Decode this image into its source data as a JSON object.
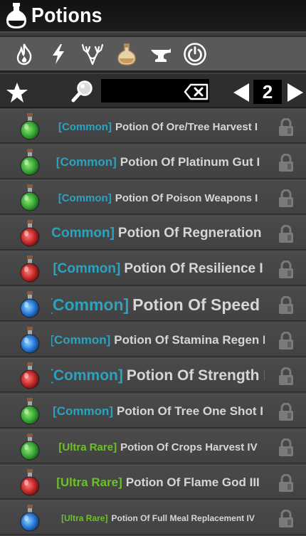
{
  "window": {
    "title": "Potions",
    "title_icon": "potion-flask-icon"
  },
  "categories": [
    {
      "name": "fire-icon",
      "selected": false
    },
    {
      "name": "lightning-icon",
      "selected": false
    },
    {
      "name": "antlers-icon",
      "selected": false
    },
    {
      "name": "potion-icon",
      "selected": true
    },
    {
      "name": "anvil-icon",
      "selected": false
    },
    {
      "name": "power-icon",
      "selected": false
    }
  ],
  "filter": {
    "search_value": "",
    "search_placeholder": "",
    "page": "2"
  },
  "colors": {
    "common": "#2aa3c0",
    "ultra_rare": "#6cc12a",
    "item_text": "#d6d6d6"
  },
  "items": [
    {
      "rarity": "[Common]",
      "name": "Potion Of Ore/Tree Harvest I",
      "color": "green"
    },
    {
      "rarity": "[Common]",
      "name": "Potion Of Platinum Gut I",
      "color": "green"
    },
    {
      "rarity": "[Common]",
      "name": "Potion Of Poison Weapons I",
      "color": "green"
    },
    {
      "rarity": "[Common]",
      "name": "Potion Of Regneration I",
      "color": "red"
    },
    {
      "rarity": "[Common]",
      "name": "Potion Of Resilience I",
      "color": "red"
    },
    {
      "rarity": "[Common]",
      "name": "Potion Of Speed I",
      "color": "blue"
    },
    {
      "rarity": "[Common]",
      "name": "Potion Of Stamina Regen I",
      "color": "blue"
    },
    {
      "rarity": "[Common]",
      "name": "Potion Of Strength I",
      "color": "red"
    },
    {
      "rarity": "[Common]",
      "name": "Potion Of Tree One Shot I",
      "color": "green"
    },
    {
      "rarity": "[Ultra Rare]",
      "name": "Potion Of Crops Harvest IV",
      "color": "green"
    },
    {
      "rarity": "[Ultra Rare]",
      "name": "Potion Of Flame God III",
      "color": "red"
    },
    {
      "rarity": "[Ultra Rare]",
      "name": "Potion Of Full Meal Replacement IV",
      "color": "blue"
    }
  ]
}
